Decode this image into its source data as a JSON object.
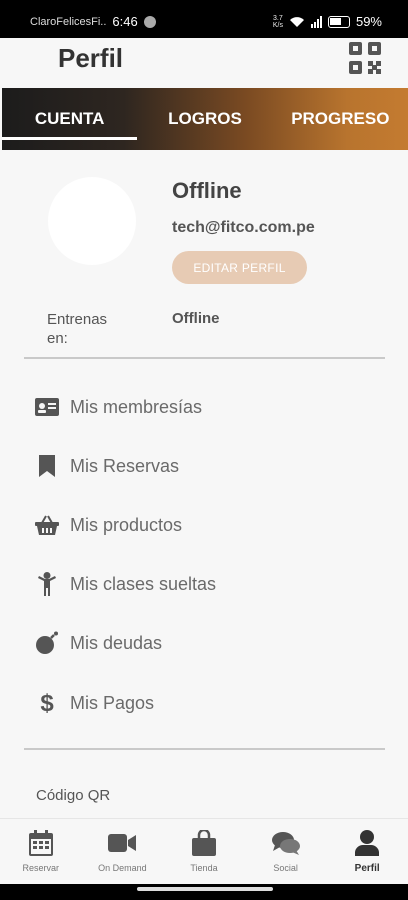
{
  "status_bar": {
    "carrier": "ClaroFelicesFi..",
    "time": "6:46",
    "net_speed_top": "3.7",
    "net_speed_bottom": "K/s",
    "battery": "59%"
  },
  "header": {
    "title": "Perfil"
  },
  "tabs": [
    {
      "label": "CUENTA",
      "active": true
    },
    {
      "label": "LOGROS",
      "active": false
    },
    {
      "label": "PROGRESO",
      "active": false
    }
  ],
  "profile": {
    "name": "Offline",
    "email": "tech@fitco.com.pe",
    "edit_button": "EDITAR PERFIL",
    "trains_label": "Entrenas en:",
    "trains_value": "Offline"
  },
  "menu": [
    {
      "label": "Mis membresías",
      "icon": "id-card-icon"
    },
    {
      "label": "Mis Reservas",
      "icon": "bookmark-icon"
    },
    {
      "label": "Mis productos",
      "icon": "basket-icon"
    },
    {
      "label": "Mis clases sueltas",
      "icon": "person-icon"
    },
    {
      "label": "Mis deudas",
      "icon": "bomb-icon"
    },
    {
      "label": "Mis Pagos",
      "icon": "dollar-icon"
    }
  ],
  "qr_section_label": "Código QR",
  "bottom_nav": [
    {
      "label": "Reservar",
      "icon": "calendar-icon"
    },
    {
      "label": "On Demand",
      "icon": "video-camera-icon"
    },
    {
      "label": "Tienda",
      "icon": "shopping-bag-icon"
    },
    {
      "label": "Social",
      "icon": "chat-bubbles-icon"
    },
    {
      "label": "Perfil",
      "icon": "user-icon",
      "active": true
    }
  ],
  "colors": {
    "accent": "#c47b30",
    "edit_button_bg": "#e7cbb4",
    "text_primary": "#444444"
  }
}
